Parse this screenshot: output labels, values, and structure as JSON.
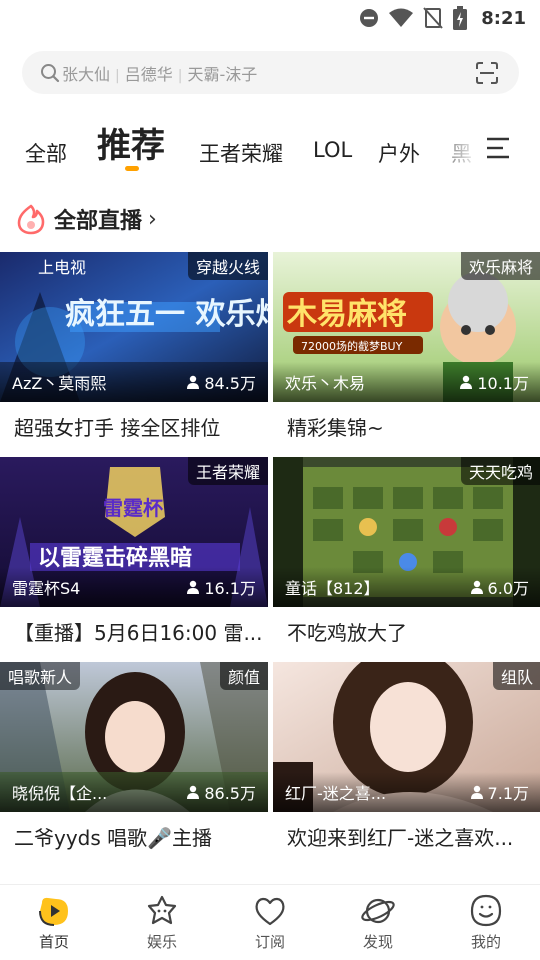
{
  "status_bar": {
    "time": "8:21"
  },
  "search": {
    "hints": [
      "张大仙",
      "吕德华",
      "天霸-沫子"
    ]
  },
  "tabs": [
    {
      "label": "全部"
    },
    {
      "label": "推荐"
    },
    {
      "label": "王者荣耀"
    },
    {
      "label": "LOL"
    },
    {
      "label": "户外"
    },
    {
      "label": "黑"
    }
  ],
  "section": {
    "title": "全部直播",
    "arrow": "›"
  },
  "cards": [
    {
      "category": "穿越火线",
      "corner_label": "上电视",
      "streamer": "AzZ丶莫雨熙",
      "viewers": "84.5万",
      "title": "超强女打手  接全区排位",
      "thumb_text": "疯狂五一 欢乐炸宝"
    },
    {
      "category": "欢乐麻将",
      "corner_label": "",
      "streamer": "欢乐丶木易",
      "viewers": "10.1万",
      "title": "精彩集锦~",
      "thumb_text": "木易麻将",
      "thumb_sub": "72000场的截梦BUY"
    },
    {
      "category": "王者荣耀",
      "corner_label": "",
      "streamer": "雷霆杯S4",
      "viewers": "16.1万",
      "title": "【重播】5月6日16:00 雷...",
      "thumb_text": "以雷霆击碎黑暗",
      "thumb_sub": "雷霆杯"
    },
    {
      "category": "天天吃鸡",
      "corner_label": "",
      "streamer": "童话【812】",
      "viewers": "6.0万",
      "title": "不吃鸡放大了"
    },
    {
      "category": "颜值",
      "corner_label": "唱歌新人",
      "streamer": "晓倪倪【企...",
      "viewers": "86.5万",
      "title": "二爷yyds 唱歌🎤主播"
    },
    {
      "category": "组队",
      "corner_label": "",
      "streamer": "红厂-迷之喜...",
      "viewers": "7.1万",
      "title": "欢迎来到红厂-迷之喜欢..."
    }
  ],
  "bottom_nav": [
    {
      "label": "首页",
      "icon": "home-play-icon",
      "active": true
    },
    {
      "label": "娱乐",
      "icon": "star-face-icon"
    },
    {
      "label": "订阅",
      "icon": "heart-icon"
    },
    {
      "label": "发现",
      "icon": "planet-icon"
    },
    {
      "label": "我的",
      "icon": "smile-face-icon"
    }
  ],
  "colors": {
    "accent": "#ffa100",
    "brand_icon": "#ff6a6a"
  }
}
